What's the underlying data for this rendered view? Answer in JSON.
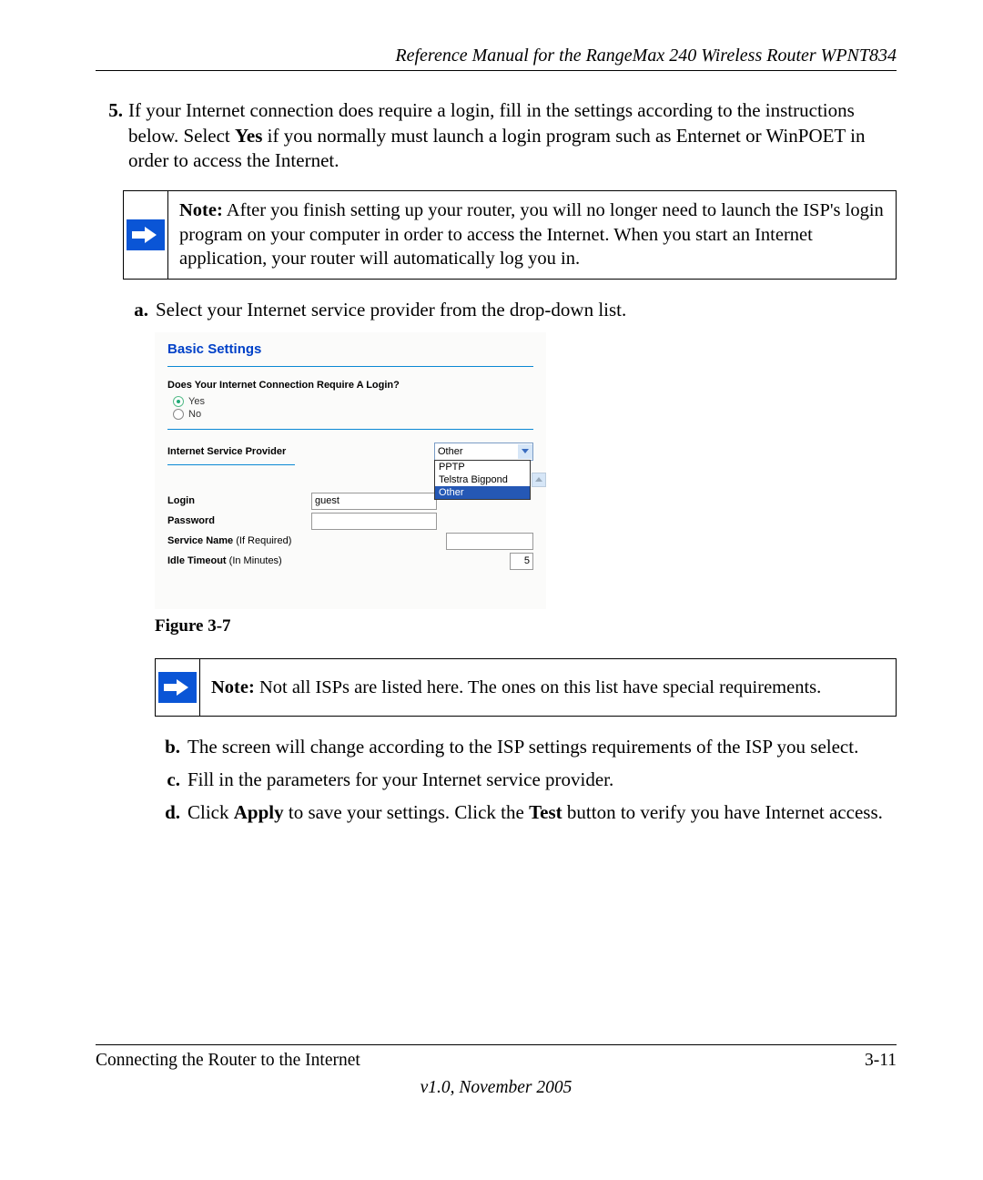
{
  "header": {
    "title": "Reference Manual for the RangeMax 240 Wireless Router WPNT834"
  },
  "step5": {
    "num": "5.",
    "text_a": "If your Internet connection does require a login, fill in the settings according to the instructions below. Select ",
    "bold1": "Yes",
    "text_b": " if you normally must launch a login program such as Enternet or WinPOET in order to access the Internet."
  },
  "note1": {
    "label": "Note:",
    "text": " After you finish setting up your router, you will no longer need to launch the ISP's login program on your computer in order to access the Internet. When you start an Internet application, your router will automatically log you in."
  },
  "sub_a": {
    "label": "a.",
    "text": "Select your Internet service provider from the drop-down list."
  },
  "figure": {
    "title": "Basic Settings",
    "question": "Does Your Internet Connection Require A Login?",
    "radio_yes": "Yes",
    "radio_no": "No",
    "isp_label": "Internet Service Provider",
    "isp_selected": "Other",
    "isp_options": [
      "PPTP",
      "Telstra Bigpond",
      "Other"
    ],
    "login_label": "Login",
    "login_value": "guest",
    "password_label": "Password",
    "service_label": "Service Name",
    "service_light": " (If Required)",
    "idle_label": "Idle Timeout",
    "idle_light": " (In Minutes)",
    "idle_value": "5"
  },
  "figure_caption": "Figure 3-7",
  "note2": {
    "label": "Note:",
    "text": " Not all ISPs are listed here. The ones on this list have special requirements."
  },
  "sub_b": {
    "label": "b.",
    "text": "The screen will change according to the ISP settings requirements of the ISP you select."
  },
  "sub_c": {
    "label": "c.",
    "text": "Fill in the parameters for your Internet service provider."
  },
  "sub_d": {
    "label": "d.",
    "pre": "Click ",
    "bold1": "Apply",
    "mid": " to save your settings. Click the ",
    "bold2": "Test",
    "post": " button to verify you have Internet access."
  },
  "footer": {
    "left": "Connecting the Router to the Internet",
    "right": "3-11",
    "version": "v1.0, November 2005"
  }
}
